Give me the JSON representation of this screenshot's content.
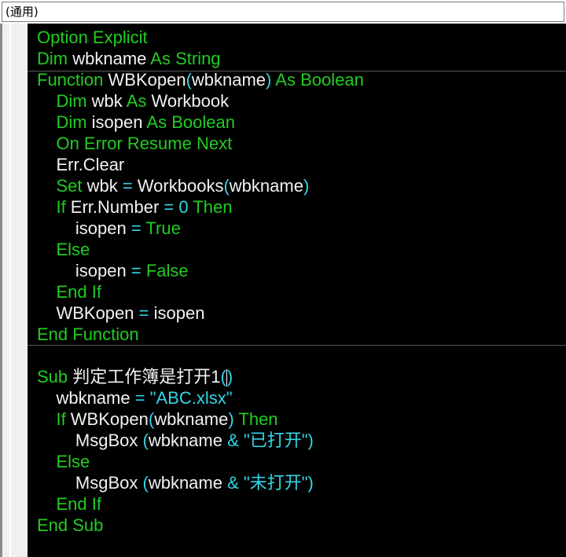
{
  "procedure_combo": {
    "value": "(通用)"
  },
  "code_lines": [
    [
      {
        "t": "Option Explicit",
        "c": "kw"
      }
    ],
    [
      {
        "t": "Dim ",
        "c": "kw"
      },
      {
        "t": "wbkname ",
        "c": "id"
      },
      {
        "t": "As String",
        "c": "kw"
      }
    ],
    [
      {
        "t": "Function ",
        "c": "kw"
      },
      {
        "t": "WBKopen",
        "c": "id"
      },
      {
        "t": "(",
        "c": "op"
      },
      {
        "t": "wbkname",
        "c": "id"
      },
      {
        "t": ") ",
        "c": "op"
      },
      {
        "t": "As Boolean",
        "c": "kw"
      }
    ],
    [
      {
        "t": "    "
      },
      {
        "t": "Dim ",
        "c": "kw"
      },
      {
        "t": "wbk ",
        "c": "id"
      },
      {
        "t": "As ",
        "c": "kw"
      },
      {
        "t": "Workbook",
        "c": "id"
      }
    ],
    [
      {
        "t": "    "
      },
      {
        "t": "Dim ",
        "c": "kw"
      },
      {
        "t": "isopen ",
        "c": "id"
      },
      {
        "t": "As Boolean",
        "c": "kw"
      }
    ],
    [
      {
        "t": "    "
      },
      {
        "t": "On Error Resume Next",
        "c": "kw"
      }
    ],
    [
      {
        "t": "    "
      },
      {
        "t": "Err.Clear",
        "c": "id"
      }
    ],
    [
      {
        "t": "    "
      },
      {
        "t": "Set ",
        "c": "kw"
      },
      {
        "t": "wbk ",
        "c": "id"
      },
      {
        "t": "= ",
        "c": "op"
      },
      {
        "t": "Workbooks",
        "c": "id"
      },
      {
        "t": "(",
        "c": "op"
      },
      {
        "t": "wbkname",
        "c": "id"
      },
      {
        "t": ")",
        "c": "op"
      }
    ],
    [
      {
        "t": "    "
      },
      {
        "t": "If ",
        "c": "kw"
      },
      {
        "t": "Err.Number ",
        "c": "id"
      },
      {
        "t": "= 0 ",
        "c": "op"
      },
      {
        "t": "Then",
        "c": "kw"
      }
    ],
    [
      {
        "t": "        "
      },
      {
        "t": "isopen ",
        "c": "id"
      },
      {
        "t": "= ",
        "c": "op"
      },
      {
        "t": "True",
        "c": "kw"
      }
    ],
    [
      {
        "t": "    "
      },
      {
        "t": "Else",
        "c": "kw"
      }
    ],
    [
      {
        "t": "        "
      },
      {
        "t": "isopen ",
        "c": "id"
      },
      {
        "t": "= ",
        "c": "op"
      },
      {
        "t": "False",
        "c": "kw"
      }
    ],
    [
      {
        "t": "    "
      },
      {
        "t": "End If",
        "c": "kw"
      }
    ],
    [
      {
        "t": "    "
      },
      {
        "t": "WBKopen ",
        "c": "id"
      },
      {
        "t": "= ",
        "c": "op"
      },
      {
        "t": "isopen",
        "c": "id"
      }
    ],
    [
      {
        "t": "End Function",
        "c": "kw"
      }
    ],
    [],
    [
      {
        "t": "Sub ",
        "c": "kw"
      },
      {
        "t": "判定工作簿是打开1",
        "c": "id"
      },
      {
        "t": "(",
        "c": "op"
      },
      {
        "caret": true
      },
      {
        "t": ")",
        "c": "op"
      }
    ],
    [
      {
        "t": "    "
      },
      {
        "t": "wbkname ",
        "c": "id"
      },
      {
        "t": "= ",
        "c": "op"
      },
      {
        "t": "\"ABC.xlsx\"",
        "c": "str"
      }
    ],
    [
      {
        "t": "    "
      },
      {
        "t": "If ",
        "c": "kw"
      },
      {
        "t": "WBKopen",
        "c": "id"
      },
      {
        "t": "(",
        "c": "op"
      },
      {
        "t": "wbkname",
        "c": "id"
      },
      {
        "t": ") ",
        "c": "op"
      },
      {
        "t": "Then",
        "c": "kw"
      }
    ],
    [
      {
        "t": "        "
      },
      {
        "t": "MsgBox ",
        "c": "id"
      },
      {
        "t": "(",
        "c": "op"
      },
      {
        "t": "wbkname ",
        "c": "id"
      },
      {
        "t": "& ",
        "c": "op"
      },
      {
        "t": "\"已打开\"",
        "c": "str"
      },
      {
        "t": ")",
        "c": "op"
      }
    ],
    [
      {
        "t": "    "
      },
      {
        "t": "Else",
        "c": "kw"
      }
    ],
    [
      {
        "t": "        "
      },
      {
        "t": "MsgBox ",
        "c": "id"
      },
      {
        "t": "(",
        "c": "op"
      },
      {
        "t": "wbkname ",
        "c": "id"
      },
      {
        "t": "& ",
        "c": "op"
      },
      {
        "t": "\"未打开\"",
        "c": "str"
      },
      {
        "t": ")",
        "c": "op"
      }
    ],
    [
      {
        "t": "    "
      },
      {
        "t": "End If",
        "c": "kw"
      }
    ],
    [
      {
        "t": "End Sub",
        "c": "kw"
      }
    ]
  ]
}
